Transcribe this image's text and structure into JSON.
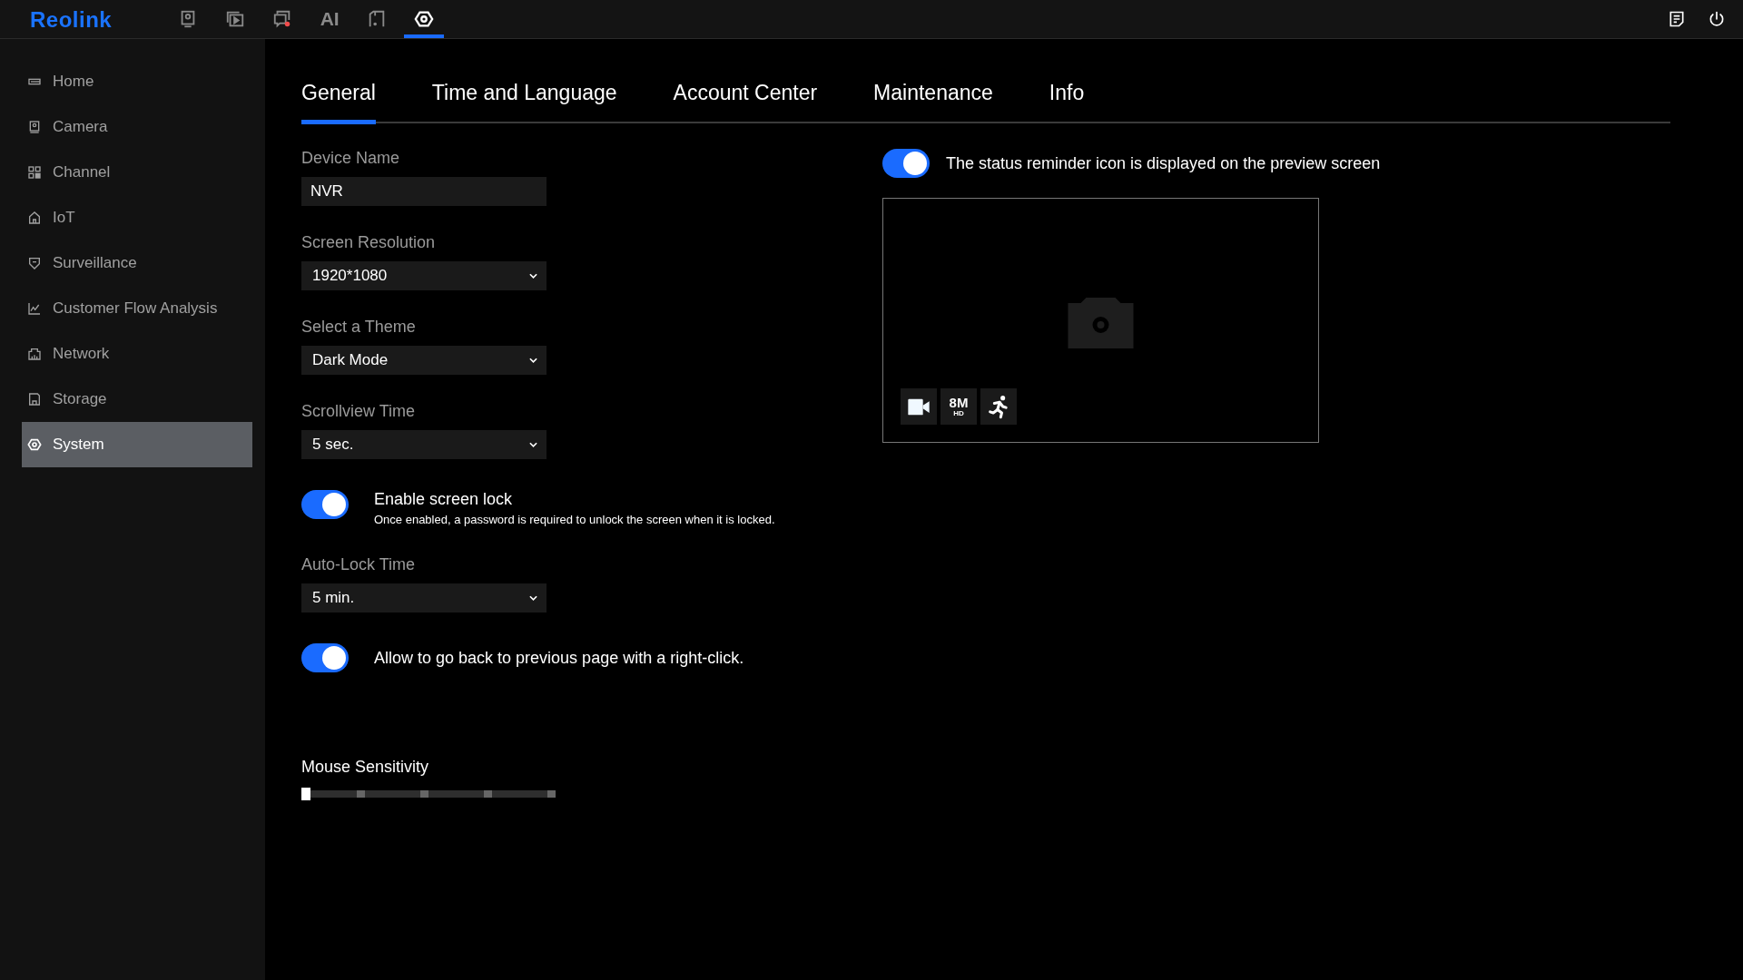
{
  "top_bar": {
    "logo": "Reolink",
    "nav": [
      {
        "kind": "preview",
        "selected": false
      },
      {
        "kind": "playback",
        "selected": false
      },
      {
        "kind": "alarm",
        "selected": false
      },
      {
        "kind": "ai",
        "label": "AI",
        "selected": false
      },
      {
        "kind": "files",
        "selected": false
      },
      {
        "kind": "system",
        "selected": true
      }
    ],
    "actions": [
      {
        "kind": "notes"
      },
      {
        "kind": "power"
      }
    ]
  },
  "sidebar": {
    "items": [
      {
        "kind": "home",
        "label": "Home",
        "selected": false
      },
      {
        "kind": "camera",
        "label": "Camera",
        "selected": false
      },
      {
        "kind": "channel",
        "label": "Channel",
        "selected": false
      },
      {
        "kind": "iot",
        "label": "IoT",
        "selected": false
      },
      {
        "kind": "surveillance",
        "label": "Surveillance",
        "selected": false
      },
      {
        "kind": "chart",
        "label": "Customer Flow Analysis",
        "selected": false
      },
      {
        "kind": "network",
        "label": "Network",
        "selected": false
      },
      {
        "kind": "storage",
        "label": "Storage",
        "selected": false
      },
      {
        "kind": "system",
        "label": "System",
        "selected": true
      }
    ]
  },
  "tabs": [
    {
      "label": "General",
      "selected": true
    },
    {
      "label": "Time and Language",
      "selected": false
    },
    {
      "label": "Account Center",
      "selected": false
    },
    {
      "label": "Maintenance",
      "selected": false
    },
    {
      "label": "Info",
      "selected": false
    }
  ],
  "settings": [
    {
      "kind": "text",
      "label": "Device Name",
      "value": "NVR"
    },
    {
      "kind": "select",
      "label": "Screen Resolution",
      "value": "1920*1080"
    },
    {
      "kind": "select",
      "label": "Select a Theme",
      "value": "Dark Mode"
    },
    {
      "kind": "select",
      "label": "Scrollview Time",
      "value": "5 sec."
    },
    {
      "kind": "toggle",
      "label": "Enable screen lock",
      "note": "Once enabled, a password is required to unlock the screen when it is locked.",
      "on": true
    },
    {
      "kind": "select",
      "label": "Auto-Lock Time",
      "value": "5 min."
    },
    {
      "kind": "toggle",
      "label": "Allow to go back to previous page with a right-click.",
      "on": true
    },
    {
      "kind": "slider",
      "label": "Mouse Sensitivity",
      "level": 0
    }
  ],
  "status_reminder": {
    "label": "The status reminder icon is displayed on the preview screen",
    "on": true,
    "preview": {
      "badges": [
        {
          "kind": "record"
        },
        {
          "kind": "resolution",
          "text": "8M",
          "subtext": "HD"
        },
        {
          "kind": "motion"
        }
      ]
    }
  }
}
